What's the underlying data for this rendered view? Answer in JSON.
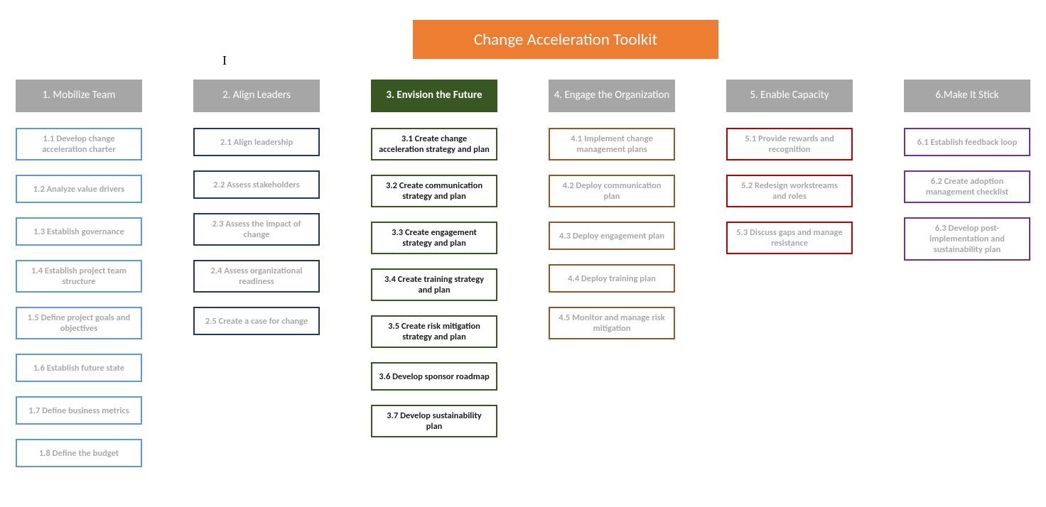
{
  "title": "Change Acceleration Toolkit",
  "columns": [
    {
      "header": "1. Mobilize Team",
      "header_style": "gray",
      "item_style": "blue",
      "items": [
        "1.1 Develop change acceleration charter",
        "1.2 Analyze value drivers",
        "1.3 Establish governance",
        "1.4 Establish project team structure",
        "1.5 Define project goals and objectives",
        "1.6 Establish future state",
        "1.7 Define business metrics",
        "1.8 Define the budget"
      ]
    },
    {
      "header": "2. Align Leaders",
      "header_style": "gray",
      "item_style": "navy",
      "items": [
        "2.1 Align leadership",
        "2.2 Assess stakeholders",
        "2.3 Assess the impact of change",
        "2.4 Assess organizational readiness",
        "2.5 Create a case for change"
      ]
    },
    {
      "header": "3. Envision the Future",
      "header_style": "dark",
      "item_style": "green",
      "items": [
        "3.1 Create change acceleration strategy and plan",
        "3.2 Create communication strategy and plan",
        "3.3 Create engagement strategy and plan",
        "3.4 Create training strategy and plan",
        "3.5 Create risk mitigation strategy and plan",
        "3.6 Develop sponsor roadmap",
        "3.7 Develop sustainability plan"
      ]
    },
    {
      "header": "4. Engage the Organization",
      "header_style": "gray",
      "item_style": "brown",
      "items": [
        "4.1 Implement change management plans",
        "4.2 Deploy communication plan",
        "4.3 Deploy engagement plan",
        "4.4 Deploy training plan",
        "4.5 Monitor and manage risk mitigation"
      ]
    },
    {
      "header": "5. Enable Capacity",
      "header_style": "gray",
      "item_style": "red",
      "items": [
        "5.1 Provide rewards and recognition",
        "5.2 Redesign workstreams and roles",
        "5.3 Discuss gaps and manage resistance"
      ]
    },
    {
      "header": "6.Make It Stick",
      "header_style": "gray",
      "item_style": "purple",
      "items": [
        "6.1 Establish feedback loop",
        "6.2 Create adoption management checklist",
        "6.3 Develop post-implementation and sustainability plan"
      ]
    }
  ]
}
